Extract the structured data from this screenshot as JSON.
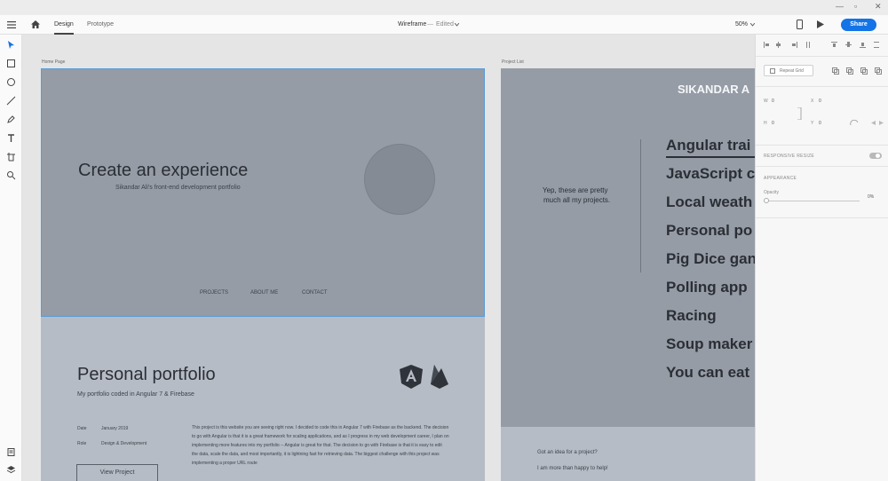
{
  "window": {
    "controls": [
      "—",
      "▫",
      "✕"
    ]
  },
  "toolbar": {
    "tabs": [
      {
        "label": "Design"
      },
      {
        "label": "Prototype"
      }
    ],
    "doc_title": "Wireframe",
    "doc_status": "Edited",
    "zoom": "50%",
    "share_label": "Share"
  },
  "artboards": {
    "home": {
      "name": "Home Page",
      "hero_title": "Create an experience",
      "hero_subtitle": "Sikandar Ali's front-end development portfolio",
      "nav": [
        "PROJECTS",
        "ABOUT ME",
        "CONTACT"
      ],
      "portfolio_title": "Personal portfolio",
      "portfolio_subtitle": "My portfolio coded in Angular 7 & Firebase",
      "date_label": "Date",
      "date_value": "January 2019",
      "role_label": "Role",
      "role_value": "Design & Development",
      "description": "This project is this website you are seeing right now. I decided to code this in Angular 7 with Firebase as the backend. The decision to go with Angular is that it is a great framework for scaling applications, and as I progress in my web development career, I plan on implementing more features into my portfolio -- Angular is great for that. The decision to go with Firebase is that it is easy to edit the data, scale the data, and most importantly, it is lightning fast for retrieving data. The biggest challenge with this project was implementing a proper URL route",
      "view_button": "View Project"
    },
    "projects": {
      "name": "Project List",
      "brand": "SIKANDAR A",
      "intro_line1": "Yep, these are pretty",
      "intro_line2": "much all my projects.",
      "items": [
        "Angular trai",
        "JavaScript c",
        "Local weath",
        "Personal po",
        "Pig Dice gan",
        "Polling app",
        "Racing",
        "Soup maker",
        "You can eat"
      ],
      "footer_line1": "Got an idea for a project?",
      "footer_line2": "I am more than happy to help!"
    }
  },
  "inspector": {
    "repeat_grid": "Repeat Grid",
    "w_label": "W",
    "w_value": "0",
    "x_label": "X",
    "x_value": "0",
    "h_label": "H",
    "h_value": "0",
    "y_label": "Y",
    "y_value": "0",
    "responsive_resize": "RESPONSIVE RESIZE",
    "appearance": "APPEARANCE",
    "opacity_label": "Opacity",
    "opacity_value": "0%"
  },
  "colors": {
    "accent": "#1473e6",
    "hero_bg": "#959ca6",
    "section_bg": "#b6bcc5",
    "selection": "#5b9bd5"
  }
}
